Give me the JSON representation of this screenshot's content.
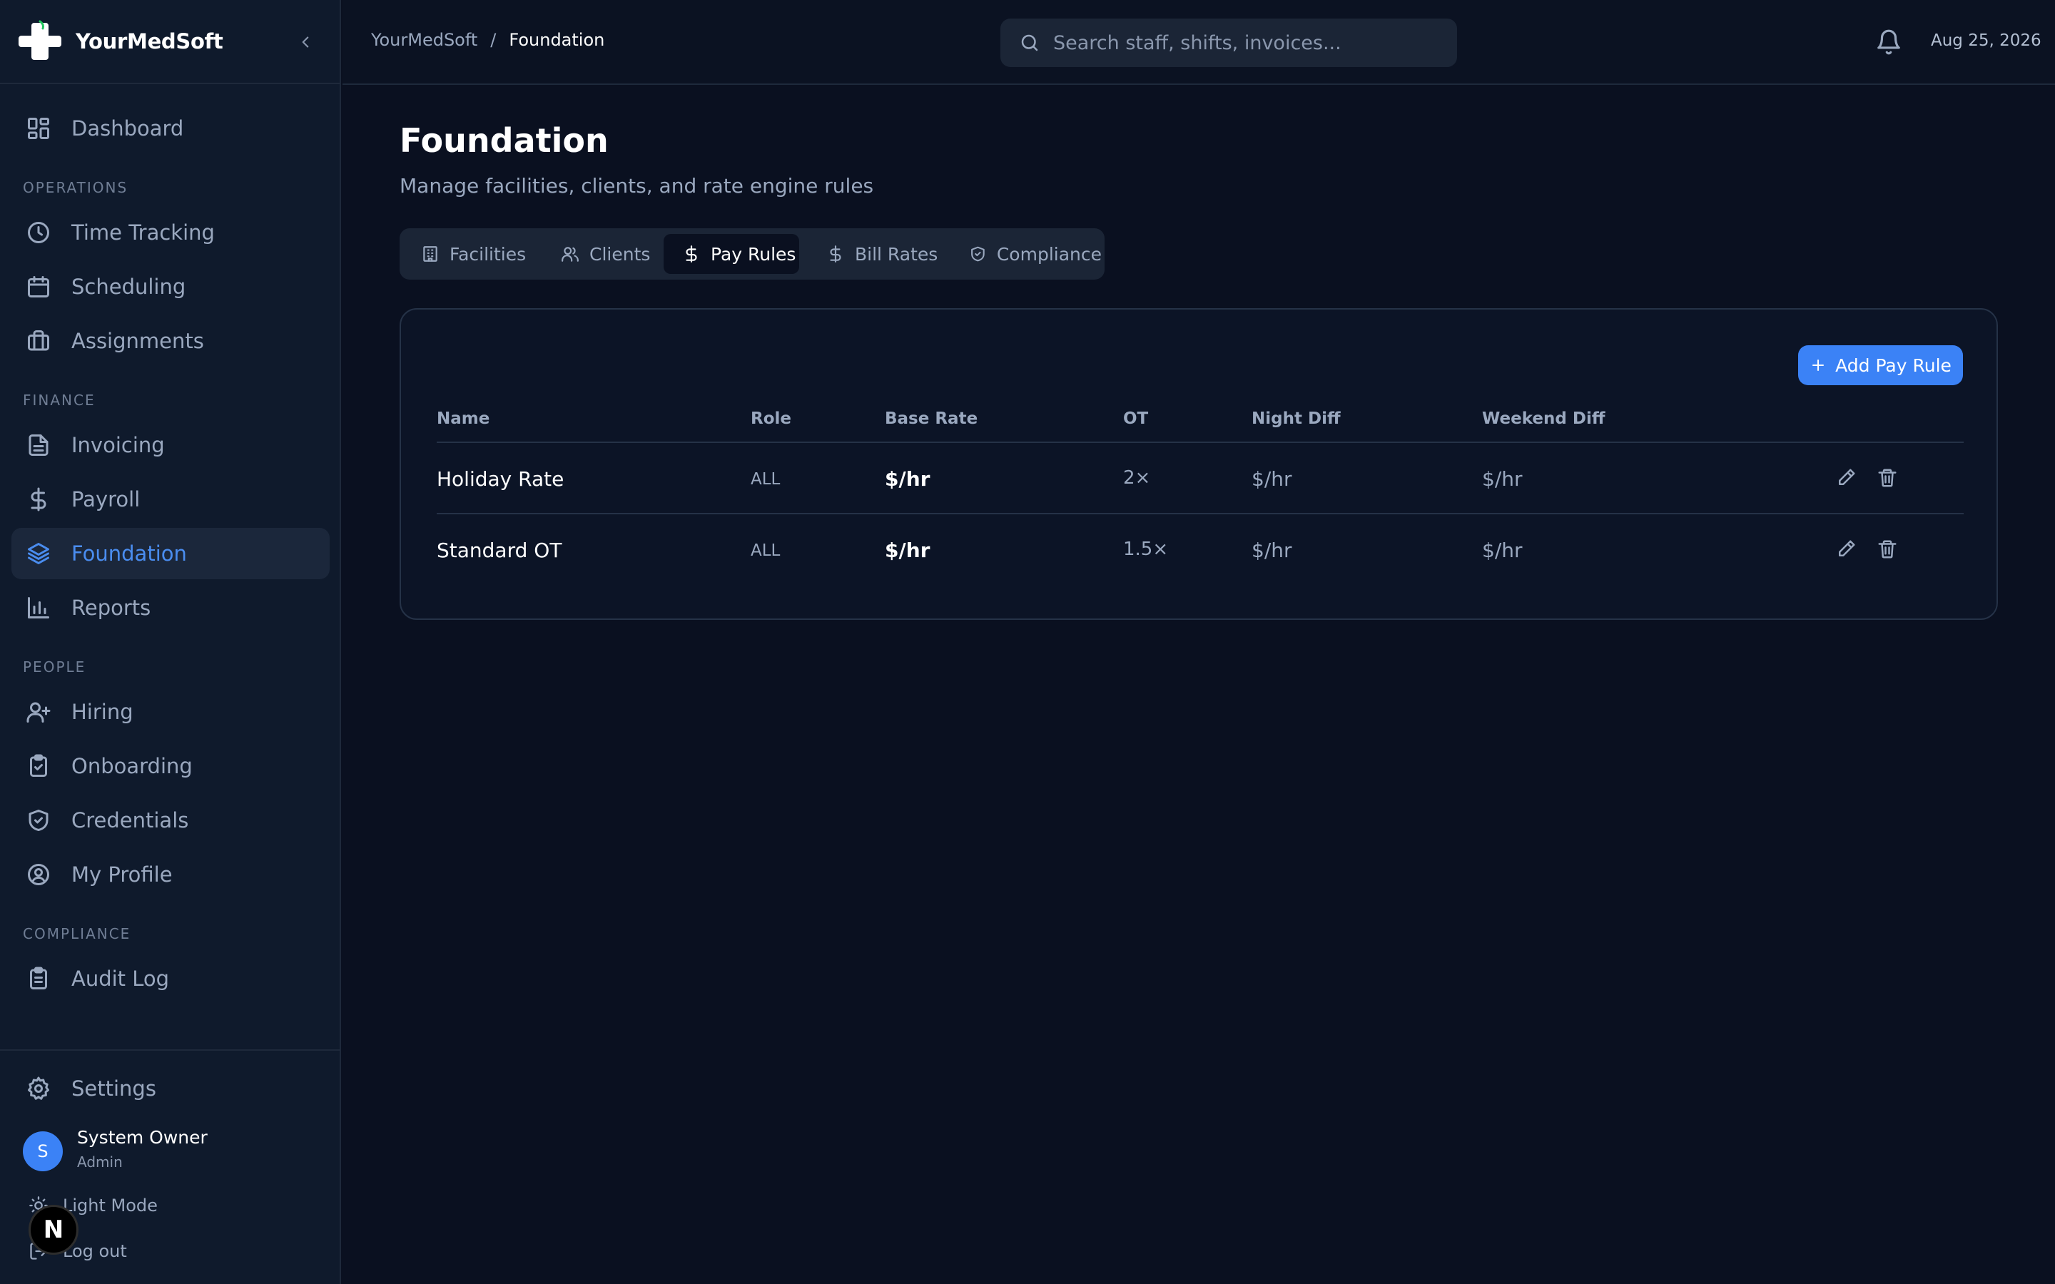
{
  "app": {
    "name": "YourMedSoft"
  },
  "sidebar": {
    "dashboard": "Dashboard",
    "sections": {
      "operations": "OPERATIONS",
      "finance": "FINANCE",
      "people": "PEOPLE",
      "compliance": "COMPLIANCE"
    },
    "items": {
      "time_tracking": "Time Tracking",
      "scheduling": "Scheduling",
      "assignments": "Assignments",
      "invoicing": "Invoicing",
      "payroll": "Payroll",
      "foundation": "Foundation",
      "reports": "Reports",
      "hiring": "Hiring",
      "onboarding": "Onboarding",
      "credentials": "Credentials",
      "my_profile": "My Profile",
      "audit_log": "Audit Log"
    },
    "settings": "Settings",
    "user": {
      "initial": "S",
      "name": "System Owner",
      "role": "Admin"
    },
    "light_mode": "Light Mode",
    "logout": "Log out",
    "next_badge": "N"
  },
  "header": {
    "breadcrumb": {
      "root": "YourMedSoft",
      "separator": "/",
      "current": "Foundation"
    },
    "search_placeholder": "Search staff, shifts, invoices...",
    "date": "Aug 25, 2026"
  },
  "page": {
    "title": "Foundation",
    "subtitle": "Manage facilities, clients, and rate engine rules"
  },
  "tabs": {
    "facilities": "Facilities",
    "clients": "Clients",
    "pay_rules": "Pay Rules",
    "bill_rates": "Bill Rates",
    "compliance": "Compliance",
    "active": "pay_rules"
  },
  "table": {
    "add_button": "Add Pay Rule",
    "columns": {
      "name": "Name",
      "role": "Role",
      "base_rate": "Base Rate",
      "ot": "OT",
      "night_diff": "Night Diff",
      "weekend_diff": "Weekend Diff"
    },
    "rows": [
      {
        "name": "Holiday Rate",
        "role": "ALL",
        "base_rate": "$/hr",
        "ot": "2×",
        "night_diff": "$/hr",
        "weekend_diff": "$/hr"
      },
      {
        "name": "Standard OT",
        "role": "ALL",
        "base_rate": "$/hr",
        "ot": "1.5×",
        "night_diff": "$/hr",
        "weekend_diff": "$/hr"
      }
    ]
  },
  "colors": {
    "background": "#0a1020",
    "sidebar": "#0f1a2c",
    "accent": "#3b82f6",
    "active_nav_text": "#4a8df0"
  },
  "icons": {
    "logo": "medical-cross-icon",
    "collapse": "chevron-left-icon",
    "search": "search-icon",
    "notifications": "bell-icon",
    "edit": "pencil-icon",
    "delete": "trash-icon"
  }
}
